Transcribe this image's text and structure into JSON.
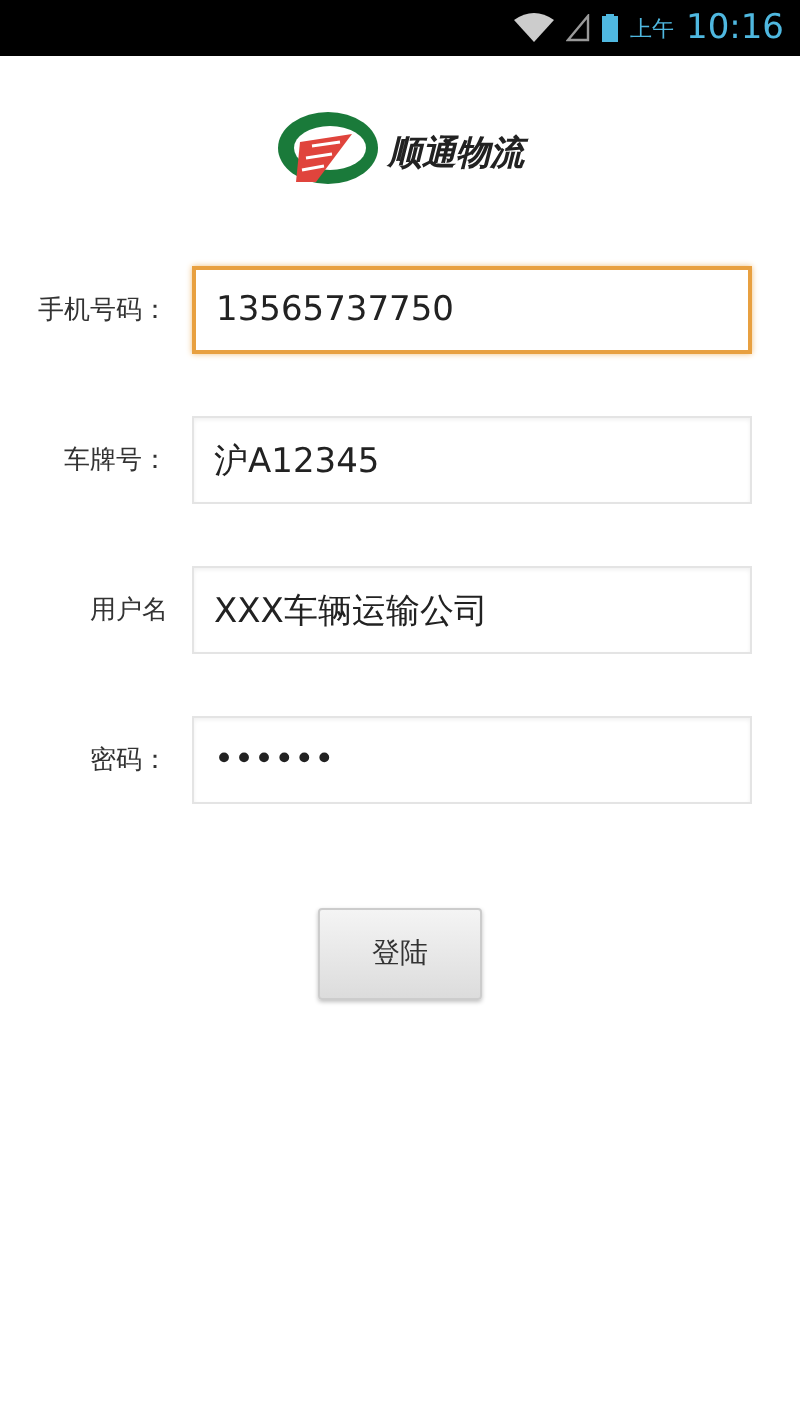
{
  "status_bar": {
    "period": "上午",
    "time": "10:16"
  },
  "logo": {
    "text": "顺通物流"
  },
  "fields": [
    {
      "label": "手机号码：",
      "value": "13565737750",
      "focused": true
    },
    {
      "label": "车牌号：",
      "value": "沪A12345",
      "focused": false
    },
    {
      "label": "用户名",
      "value": "XXX车辆运输公司",
      "focused": false
    },
    {
      "label": "密码：",
      "value": "••••••",
      "focused": false
    }
  ],
  "login_button": "登陆"
}
